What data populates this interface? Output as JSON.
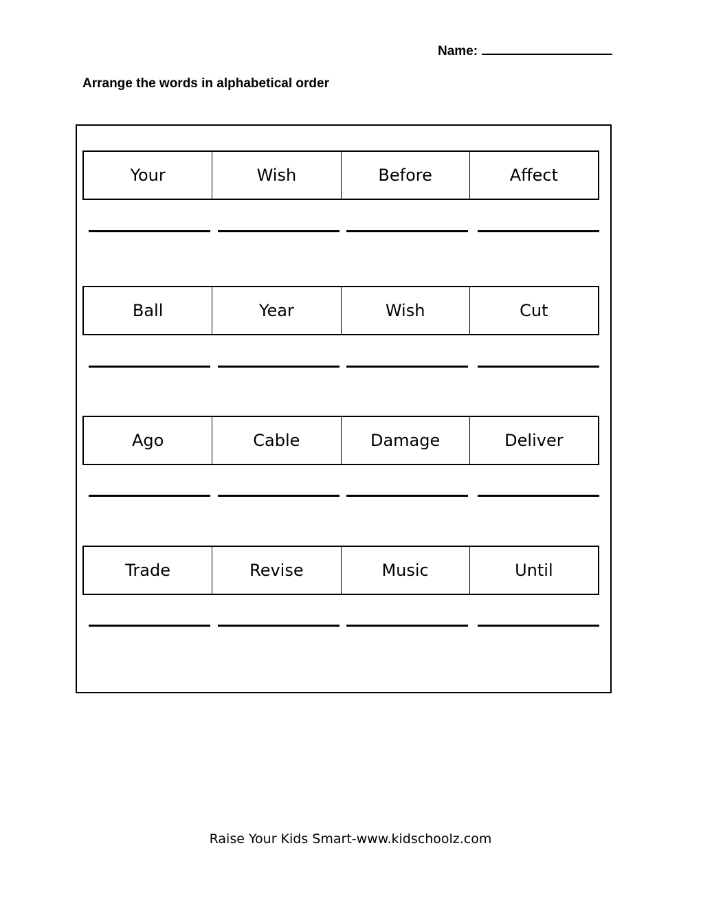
{
  "header": {
    "name_label": "Name:"
  },
  "instructions": "Arrange the words in alphabetical order",
  "exercises": [
    {
      "words": [
        "Your",
        "Wish",
        "Before",
        "Affect"
      ]
    },
    {
      "words": [
        "Ball",
        "Year",
        "Wish",
        "Cut"
      ]
    },
    {
      "words": [
        "Ago",
        "Cable",
        "Damage",
        "Deliver"
      ]
    },
    {
      "words": [
        "Trade",
        "Revise",
        "Music",
        "Until"
      ]
    }
  ],
  "footer": "Raise Your Kids Smart-www.kidschoolz.com"
}
